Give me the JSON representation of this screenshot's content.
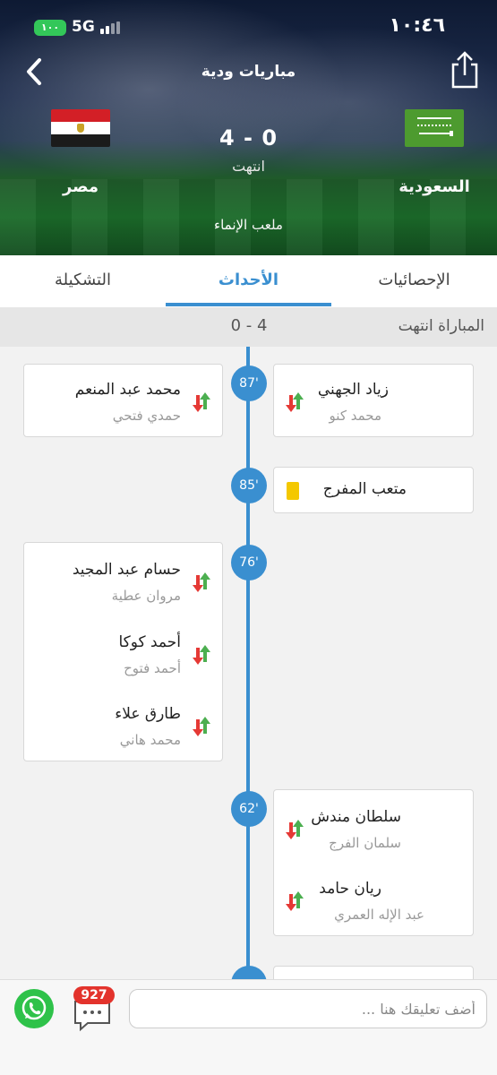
{
  "status_bar": {
    "time": "١٠:٤٦",
    "battery": "١٠٠",
    "network": "5G"
  },
  "header": {
    "title": "مباريات ودية",
    "back_icon": "chevron-left-icon",
    "share_icon": "share-icon",
    "home_team": {
      "name": "السعودية",
      "flag": "saudi-flag"
    },
    "away_team": {
      "name": "مصر",
      "flag": "egypt-flag"
    },
    "score": "4 - 0",
    "status": "انتهت",
    "stadium": "ملعب الإنماء"
  },
  "tabs": [
    {
      "label": "الإحصائيات",
      "active": false
    },
    {
      "label": "الأحداث",
      "active": true
    },
    {
      "label": "التشكيلة",
      "active": false
    }
  ],
  "match_status_row": {
    "label": "المباراة انتهت",
    "score": "0 - 4"
  },
  "events": {
    "e87": {
      "minute": "87'",
      "right": {
        "in": "زياد الجهني",
        "out": "محمد كنو"
      },
      "left": {
        "in": "محمد عبد المنعم",
        "out": "حمدي فتحي"
      }
    },
    "e85": {
      "minute": "85'",
      "player": "متعب المفرج",
      "type": "yellow-card"
    },
    "e76": {
      "minute": "76'",
      "left": [
        {
          "in": "حسام عبد المجيد",
          "out": "مروان عطية"
        },
        {
          "in": "أحمد كوكا",
          "out": "أحمد فتوح"
        },
        {
          "in": "طارق علاء",
          "out": "محمد هاني"
        }
      ]
    },
    "e62": {
      "minute": "62'",
      "right": [
        {
          "in": "سلطان مندش",
          "out": "سلمان الفرج"
        },
        {
          "in": "ريان حامد",
          "out": "عبد الإله العمري"
        }
      ]
    }
  },
  "bottom_bar": {
    "comment_placeholder": "أضف تعليقك هنا ...",
    "comments_count": "927",
    "whatsapp_icon": "whatsapp-icon",
    "comments_icon": "speech-bubble-icon"
  },
  "colors": {
    "accent": "#3a8fd0",
    "sub_in": "#4caf50",
    "sub_out": "#e53935",
    "yellow_card": "#f4c800"
  }
}
